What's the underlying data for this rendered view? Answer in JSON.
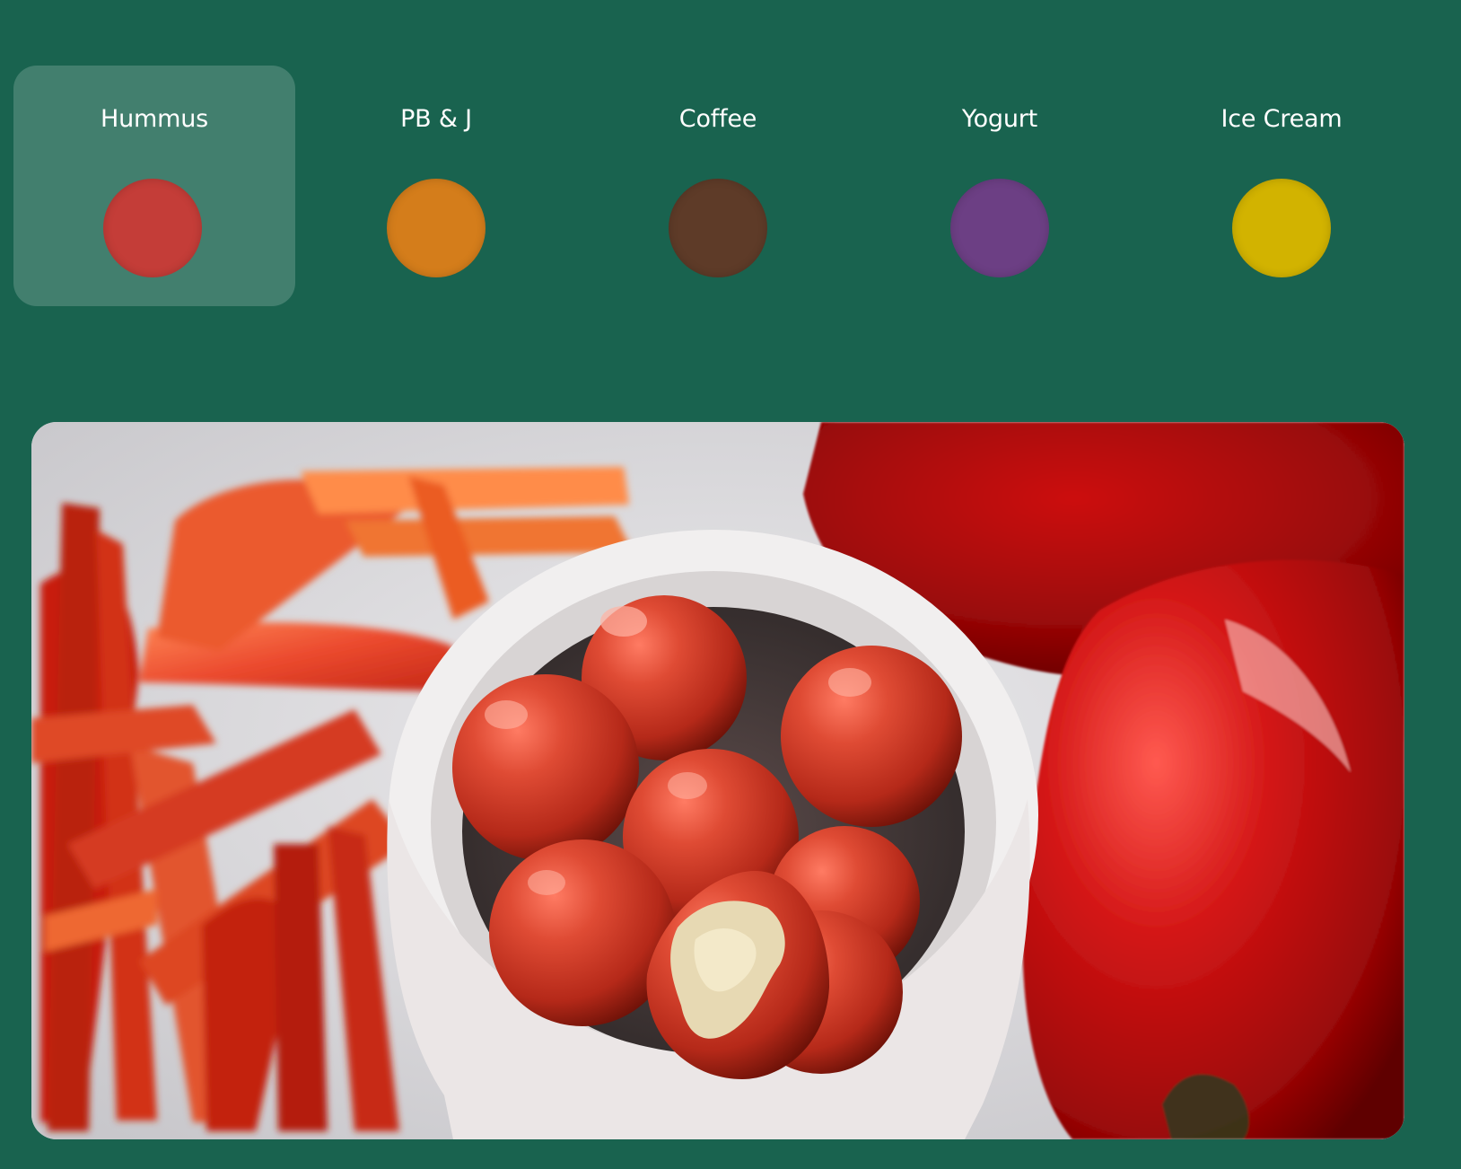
{
  "tabs": [
    {
      "label": "Hummus",
      "color": "#c43d38",
      "active": true
    },
    {
      "label": "PB & J",
      "color": "#d47d1b",
      "active": false
    },
    {
      "label": "Coffee",
      "color": "#5e3b28",
      "active": false
    },
    {
      "label": "Yogurt",
      "color": "#6c3f84",
      "active": false
    },
    {
      "label": "Ice Cream",
      "color": "#d2b300",
      "active": false
    }
  ],
  "colors": {
    "background": "#19634f",
    "active_tab_overlay": "rgba(255,255,255,0.18)"
  }
}
